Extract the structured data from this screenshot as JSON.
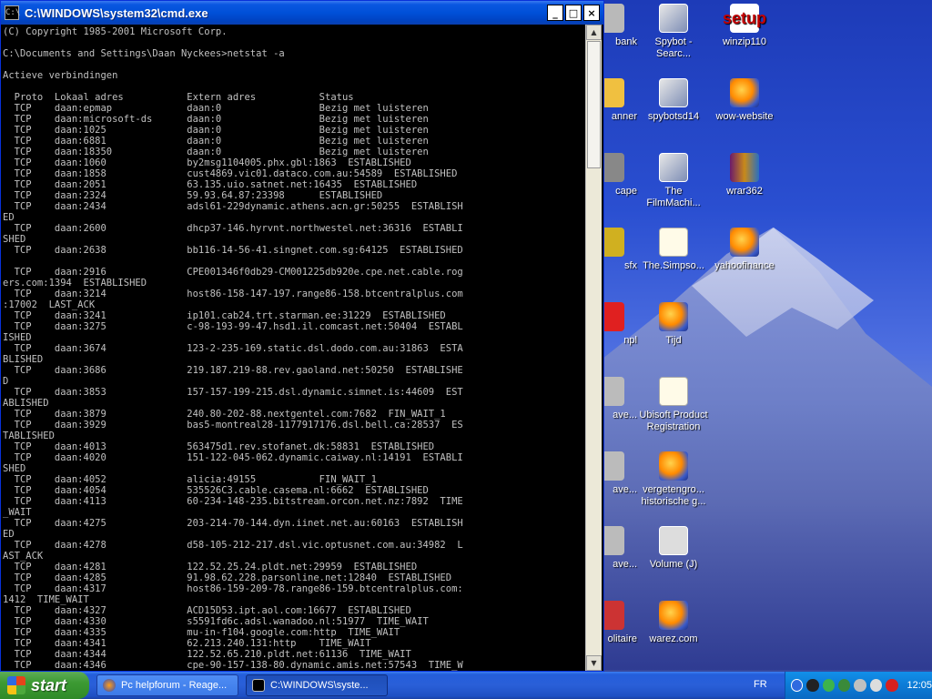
{
  "window": {
    "title": "C:\\WINDOWS\\system32\\cmd.exe",
    "icon_label": "C:\\",
    "controls": [
      "_",
      "□",
      "×"
    ]
  },
  "console": {
    "lines": [
      "(C) Copyright 1985-2001 Microsoft Corp.",
      "",
      "C:\\Documents and Settings\\Daan Nyckees>netstat -a",
      "",
      "Actieve verbindingen",
      "",
      "  Proto  Lokaal adres           Extern adres           Status",
      "  TCP    daan:epmap             daan:0                 Bezig met luisteren",
      "  TCP    daan:microsoft-ds      daan:0                 Bezig met luisteren",
      "  TCP    daan:1025              daan:0                 Bezig met luisteren",
      "  TCP    daan:6881              daan:0                 Bezig met luisteren",
      "  TCP    daan:18350             daan:0                 Bezig met luisteren",
      "  TCP    daan:1060              by2msg1104005.phx.gbl:1863  ESTABLISHED",
      "  TCP    daan:1858              cust4869.vic01.dataco.com.au:54589  ESTABLISHED",
      "  TCP    daan:2051              63.135.uio.satnet.net:16435  ESTABLISHED",
      "  TCP    daan:2324              59.93.64.87:23398      ESTABLISHED",
      "  TCP    daan:2434              adsl61-229dynamic.athens.acn.gr:50255  ESTABLISH",
      "ED",
      "  TCP    daan:2600              dhcp37-146.hyrvnt.northwestel.net:36316  ESTABLI",
      "SHED",
      "  TCP    daan:2638              bb116-14-56-41.singnet.com.sg:64125  ESTABLISHED",
      "",
      "  TCP    daan:2916              CPE001346f0db29-CM001225db920e.cpe.net.cable.rog",
      "ers.com:1394  ESTABLISHED",
      "  TCP    daan:3214              host86-158-147-197.range86-158.btcentralplus.com",
      ":17002  LAST_ACK",
      "  TCP    daan:3241              ip101.cab24.trt.starman.ee:31229  ESTABLISHED",
      "  TCP    daan:3275              c-98-193-99-47.hsd1.il.comcast.net:50404  ESTABL",
      "ISHED",
      "  TCP    daan:3674              123-2-235-169.static.dsl.dodo.com.au:31863  ESTA",
      "BLISHED",
      "  TCP    daan:3686              219.187.219-88.rev.gaoland.net:50250  ESTABLISHE",
      "D",
      "  TCP    daan:3853              157-157-199-215.dsl.dynamic.simnet.is:44609  EST",
      "ABLISHED",
      "  TCP    daan:3879              240.80-202-88.nextgentel.com:7682  FIN_WAIT_1",
      "  TCP    daan:3929              bas5-montreal28-1177917176.dsl.bell.ca:28537  ES",
      "TABLISHED",
      "  TCP    daan:4013              563475d1.rev.stofanet.dk:58831  ESTABLISHED",
      "  TCP    daan:4020              151-122-045-062.dynamic.caiway.nl:14191  ESTABLI",
      "SHED",
      "  TCP    daan:4052              alicia:49155           FIN_WAIT_1",
      "  TCP    daan:4054              535526C3.cable.casema.nl:6662  ESTABLISHED",
      "  TCP    daan:4113              60-234-148-235.bitstream.orcon.net.nz:7892  TIME",
      "_WAIT",
      "  TCP    daan:4275              203-214-70-144.dyn.iinet.net.au:60163  ESTABLISH",
      "ED",
      "  TCP    daan:4278              d58-105-212-217.dsl.vic.optusnet.com.au:34982  L",
      "AST_ACK",
      "  TCP    daan:4281              122.52.25.24.pldt.net:29959  ESTABLISHED",
      "  TCP    daan:4285              91.98.62.228.parsonline.net:12840  ESTABLISHED",
      "  TCP    daan:4317              host86-159-209-78.range86-159.btcentralplus.com:",
      "1412  TIME_WAIT",
      "  TCP    daan:4327              ACD15D53.ipt.aol.com:16677  ESTABLISHED",
      "  TCP    daan:4330              s5591fd6c.adsl.wanadoo.nl:51977  TIME_WAIT",
      "  TCP    daan:4335              mu-in-f104.google.com:http  TIME_WAIT",
      "  TCP    daan:4341              62.213.240.131:http    TIME_WAIT",
      "  TCP    daan:4344              122.52.65.210.pldt.net:61136  TIME_WAIT",
      "  TCP    daan:4346              cpe-90-157-138-80.dynamic.amis.net:57543  TIME_W"
    ]
  },
  "desktop": {
    "icons": [
      {
        "label": "bank",
        "glyph": "",
        "name": "desktop-icon-bank"
      },
      {
        "label": "Spybot - Searc...",
        "glyph": "S",
        "name": "desktop-icon-spybot"
      },
      {
        "label": "winzip110",
        "glyph": "setup",
        "name": "desktop-icon-winzip110"
      },
      {
        "label": "anner",
        "glyph": "",
        "name": "desktop-icon-anner"
      },
      {
        "label": "spybotsd14",
        "glyph": "S",
        "name": "desktop-icon-spybotsd14"
      },
      {
        "label": "wow-website",
        "glyph": "",
        "name": "desktop-icon-wow-website"
      },
      {
        "label": "cape",
        "glyph": "",
        "name": "desktop-icon-cape"
      },
      {
        "label": "The FilmMachi...",
        "glyph": "S",
        "name": "desktop-icon-filmmachine"
      },
      {
        "label": "wrar362",
        "glyph": "",
        "name": "desktop-icon-wrar362"
      },
      {
        "label": "sfx",
        "glyph": "",
        "name": "desktop-icon-sfx"
      },
      {
        "label": "The.Simpso...",
        "glyph": "",
        "name": "desktop-icon-simpsons"
      },
      {
        "label": "yahoofinance",
        "glyph": "",
        "name": "desktop-icon-yahoofinance"
      },
      {
        "label": "npl",
        "glyph": "",
        "name": "desktop-icon-npl"
      },
      {
        "label": "Tijd",
        "glyph": "",
        "name": "desktop-icon-tijd"
      },
      {
        "label": "ave...",
        "glyph": "",
        "name": "desktop-icon-ave-1"
      },
      {
        "label": "Ubisoft Product Registration",
        "glyph": "",
        "name": "desktop-icon-ubisoft"
      },
      {
        "label": "ave...",
        "glyph": "",
        "name": "desktop-icon-ave-2"
      },
      {
        "label": "vergetengro... historische g...",
        "glyph": "",
        "name": "desktop-icon-vergetengro"
      },
      {
        "label": "ave...",
        "glyph": "",
        "name": "desktop-icon-ave-3"
      },
      {
        "label": "Volume (J)",
        "glyph": "",
        "name": "desktop-icon-volume-j"
      },
      {
        "label": "olitaire",
        "glyph": "",
        "name": "desktop-icon-solitaire"
      },
      {
        "label": "warez.com",
        "glyph": "",
        "name": "desktop-icon-warez"
      }
    ]
  },
  "taskbar": {
    "start_label": "start",
    "tasks": [
      {
        "label": "Pc helpforum - Reage...",
        "icon": "firefox-icon",
        "active": false
      },
      {
        "label": "C:\\WINDOWS\\syste...",
        "icon": "cmd-icon",
        "active": true
      }
    ],
    "language": "FR",
    "clock": "12:05"
  }
}
